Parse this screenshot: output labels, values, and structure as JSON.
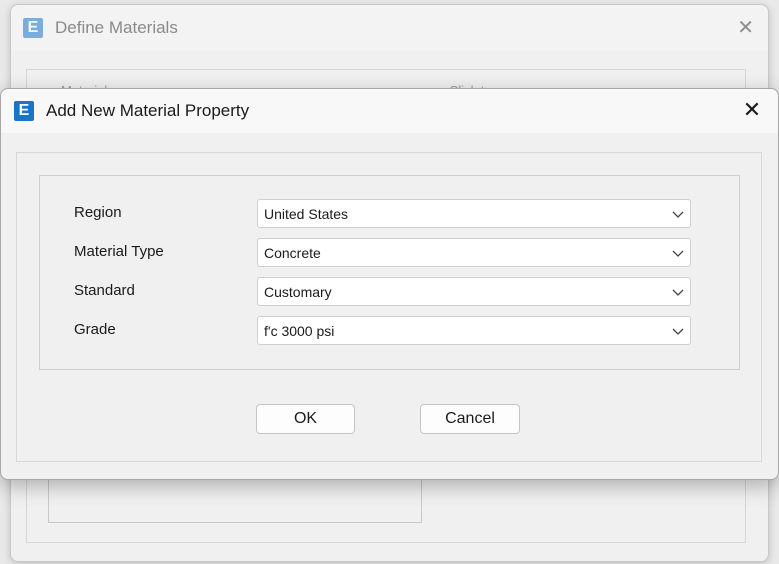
{
  "background_window": {
    "logo": "E",
    "title": "Define Materials",
    "close_icon": "close-icon",
    "col_materials": "Materials",
    "col_click": "Click to:"
  },
  "dialog": {
    "logo": "E",
    "title": "Add New Material Property",
    "close_icon": "close-icon",
    "fields": [
      {
        "label": "Region",
        "value": "United States"
      },
      {
        "label": "Material Type",
        "value": "Concrete"
      },
      {
        "label": "Standard",
        "value": "Customary"
      },
      {
        "label": "Grade",
        "value": "f'c 3000 psi"
      }
    ],
    "ok_label": "OK",
    "cancel_label": "Cancel"
  },
  "colors": {
    "brand": "#1a74c8",
    "window_bg": "#f0f0f0"
  }
}
